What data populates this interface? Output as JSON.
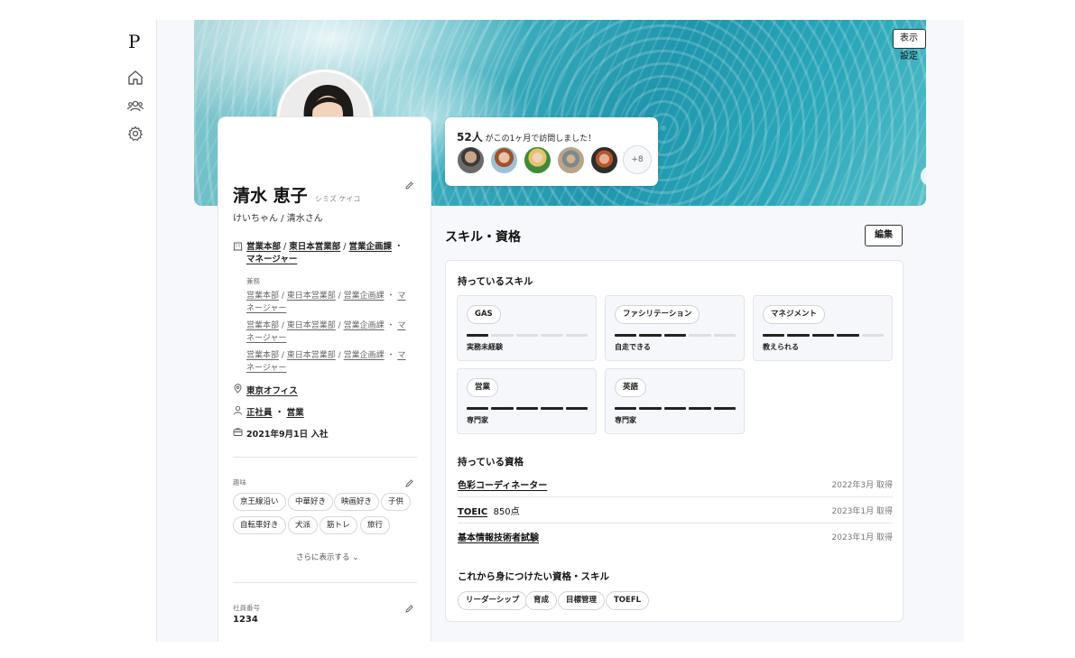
{
  "sidebar": {
    "logo": "P",
    "items": [
      {
        "icon": "home-icon"
      },
      {
        "icon": "people-icon"
      },
      {
        "icon": "gear-icon"
      }
    ]
  },
  "cover": {
    "display_settings_label": "表示設定"
  },
  "visitors": {
    "count": "52人",
    "message": "がこの1ヶ月で訪問しました！",
    "more_label": "+8"
  },
  "profile": {
    "name": "清水 恵子",
    "kana": "シミズ ケイコ",
    "nickname": "けいちゃん / 清水さん",
    "org_main": {
      "dept1": "営業本部",
      "dept2": "東日本営業部",
      "dept3": "営業企画課",
      "role": "マネージャー"
    },
    "kenmu_label": "兼務",
    "org_sub": [
      {
        "dept1": "営業本部",
        "dept2": "東日本営業部",
        "dept3": "営業企画課",
        "role": "マネージャー"
      },
      {
        "dept1": "営業本部",
        "dept2": "東日本営業部",
        "dept3": "営業企画課",
        "role": "マネージャー"
      },
      {
        "dept1": "営業本部",
        "dept2": "東日本営業部",
        "dept3": "営業企画課",
        "role": "マネージャー"
      }
    ],
    "office": "東京オフィス",
    "employment_type": "正社員",
    "job_type": "営業",
    "join_date": "2021年9月1日 入社",
    "hobby_label": "趣味",
    "hobbies": [
      "京王線沿い",
      "中華好き",
      "映画好き",
      "子供",
      "自転車好き",
      "犬派",
      "筋トレ",
      "旅行"
    ],
    "show_more_label": "さらに表示する",
    "employee_no_label": "社員番号",
    "employee_no": "1234"
  },
  "skills_section": {
    "title": "スキル・資格",
    "edit_label": "編集",
    "have_skills_title": "持っているスキル",
    "skills": [
      {
        "name": "GAS",
        "level": 1,
        "max": 5,
        "level_label": "実務未経験"
      },
      {
        "name": "ファシリテーション",
        "level": 3,
        "max": 5,
        "level_label": "自走できる"
      },
      {
        "name": "マネジメント",
        "level": 4,
        "max": 5,
        "level_label": "教えられる"
      },
      {
        "name": "営業",
        "level": 5,
        "max": 5,
        "level_label": "専門家"
      },
      {
        "name": "英語",
        "level": 5,
        "max": 5,
        "level_label": "専門家"
      }
    ],
    "certs_title": "持っている資格",
    "certs": [
      {
        "name": "色彩コーディネーター",
        "extra": "",
        "date": "2022年3月 取得"
      },
      {
        "name": "TOEIC",
        "extra": "850点",
        "date": "2023年1月 取得"
      },
      {
        "name": "基本情報技術者試験",
        "extra": "",
        "date": "2023年1月 取得"
      }
    ],
    "want_title": "これから身につけたい資格・スキル",
    "want": [
      "リーダーシップ",
      "育成",
      "目標管理",
      "TOEFL"
    ]
  }
}
